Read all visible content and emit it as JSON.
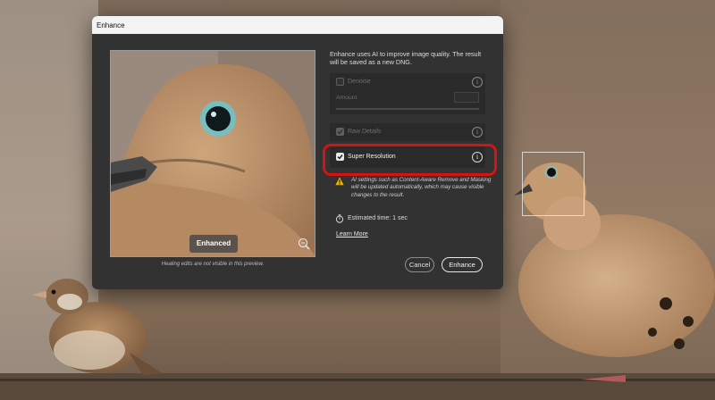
{
  "dialog": {
    "title": "Enhance",
    "intro": "Enhance uses AI to improve image quality. The result will be saved as a new DNG.",
    "preview_badge": "Enhanced",
    "preview_caption": "Healing edits are not visible in this preview.",
    "options": {
      "denoise": {
        "label": "Denoise",
        "checked": false,
        "enabled": false
      },
      "amount_label": "Amount",
      "raw_details": {
        "label": "Raw Details",
        "checked": true,
        "enabled": false
      },
      "super_resolution": {
        "label": "Super Resolution",
        "checked": true,
        "enabled": true
      }
    },
    "info_glyph": "i",
    "warning": "AI settings such as Content-Aware Remove and Masking will be updated automatically, which may cause visible changes to the result.",
    "estimated_time": "Estimated time: 1 sec",
    "learn_more": "Learn More",
    "cancel_label": "Cancel",
    "enhance_label": "Enhance"
  },
  "icons": {
    "info": "info-icon",
    "warning": "warning-triangle-icon",
    "timer": "stopwatch-icon",
    "zoom": "zoom-icon",
    "checkbox": "checkmark-icon"
  },
  "colors": {
    "dialog_bg": "#323232",
    "panel_bg": "#2a2a2a",
    "highlight_border": "#d41414",
    "warning": "#f0b400",
    "titlebar": "#f3f3f3"
  }
}
